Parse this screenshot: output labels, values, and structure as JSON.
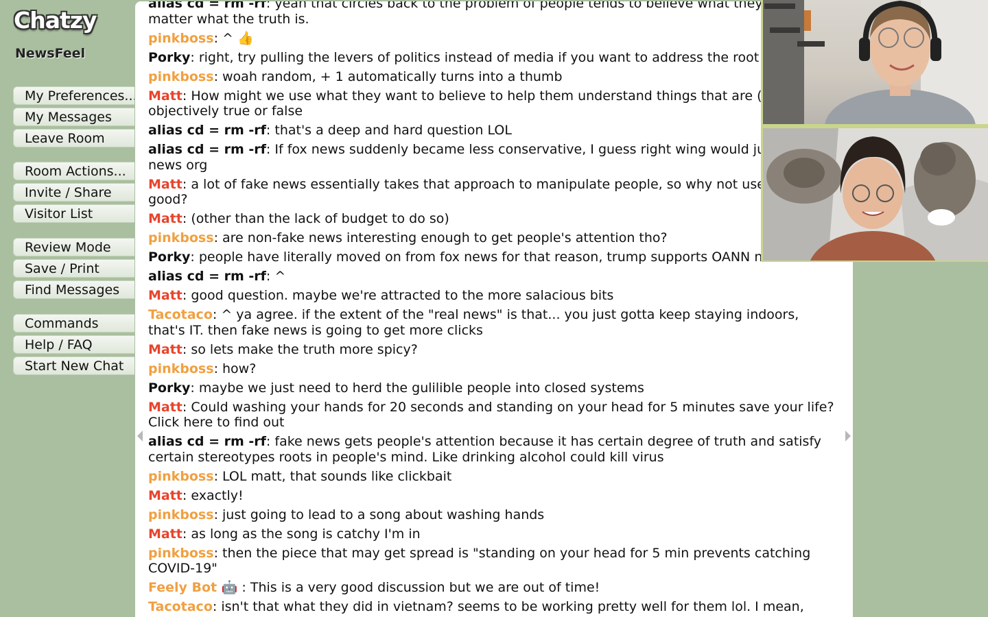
{
  "app": {
    "logo": "Chatzy",
    "room_name": "NewsFeel"
  },
  "menu": {
    "group1": [
      "My Preferences...",
      "My Messages",
      "Leave Room"
    ],
    "group2": [
      "Room Actions...",
      "Invite / Share",
      "Visitor List"
    ],
    "group3": [
      "Review Mode",
      "Save / Print",
      "Find Messages"
    ],
    "group4": [
      "Commands",
      "Help / FAQ",
      "Start New Chat"
    ]
  },
  "colors": {
    "background": "#a9bf9f",
    "matt": "#e8442c",
    "pinkboss": "#f0a040",
    "tacotaco": "#f0a040",
    "feelybot": "#f0a040",
    "default_user": "#111111",
    "video_border": "#c9d58a"
  },
  "messages": [
    {
      "user": "alias cd = rm -rf",
      "sep": ": ",
      "text": "yeah that circles back to the problem of people tends to believe what they wanna matter what the truth is.",
      "color": "default"
    },
    {
      "user": "pinkboss",
      "sep": ": ",
      "text": "^ 👍",
      "color": "orange"
    },
    {
      "user": "Porky",
      "sep": ": ",
      "text": "right, try pulling the levers of politics instead of media if you want to address the root cause",
      "color": "default"
    },
    {
      "user": "pinkboss",
      "sep": ": ",
      "text": "woah random, + 1 automatically turns into a thumb",
      "color": "orange"
    },
    {
      "user": "Matt",
      "sep": ": ",
      "text": "How might we use what they want to believe to help them understand things that are (within r objectively true or false",
      "color": "red"
    },
    {
      "user": "alias cd = rm -rf",
      "sep": ": ",
      "text": "that's a deep and hard question LOL",
      "color": "default"
    },
    {
      "user": "alias cd = rm -rf",
      "sep": ": ",
      "text": "If fox news suddenly became less conservative, I guess right wing would just crea news org",
      "color": "default"
    },
    {
      "user": "Matt",
      "sep": ": ",
      "text": "a lot of fake news essentially takes that approach to manipulate people, so why not use the sar good?",
      "color": "red"
    },
    {
      "user": "Matt",
      "sep": ": ",
      "text": "(other than the lack of budget to do so)",
      "color": "red"
    },
    {
      "user": "pinkboss",
      "sep": ": ",
      "text": "are non-fake news interesting enough to get people's attention tho?",
      "color": "orange"
    },
    {
      "user": "Porky",
      "sep": ": ",
      "text": "people have literally moved on from fox news for that reason, trump supports OANN now",
      "color": "default"
    },
    {
      "user": "alias cd = rm -rf",
      "sep": ": ",
      "text": "^",
      "color": "default"
    },
    {
      "user": "Matt",
      "sep": ": ",
      "text": "good question. maybe we're attracted to the more salacious bits",
      "color": "red"
    },
    {
      "user": "Tacotaco",
      "sep": ": ",
      "text": "^ ya agree. if the extent of the \"real news\" is that... you just gotta keep staying indoors, that's IT. then fake news is going to get more clicks",
      "color": "orange"
    },
    {
      "user": "Matt",
      "sep": ": ",
      "text": "so lets make the truth more spicy?",
      "color": "red"
    },
    {
      "user": "pinkboss",
      "sep": ": ",
      "text": "how?",
      "color": "orange"
    },
    {
      "user": "Porky",
      "sep": ": ",
      "text": "maybe we just need to herd the gulilible people into closed systems",
      "color": "default"
    },
    {
      "user": "Matt",
      "sep": ": ",
      "text": "Could washing your hands for 20 seconds and standing on your head for 5 minutes save your life? Click here to find out",
      "color": "red"
    },
    {
      "user": "alias cd = rm -rf",
      "sep": ": ",
      "text": "fake news gets people's attention because it has certain degree of truth and satisfy certain stereotypes roots in people's mind. Like drinking alcohol could kill virus",
      "color": "default"
    },
    {
      "user": "pinkboss",
      "sep": ": ",
      "text": "LOL matt, that sounds like clickbait",
      "color": "orange"
    },
    {
      "user": "Matt",
      "sep": ": ",
      "text": "exactly!",
      "color": "red"
    },
    {
      "user": "pinkboss",
      "sep": ": ",
      "text": "just going to lead to a song about washing hands",
      "color": "orange"
    },
    {
      "user": "Matt",
      "sep": ": ",
      "text": "as long as the song is catchy I'm in",
      "color": "red"
    },
    {
      "user": "pinkboss",
      "sep": ": ",
      "text": "then the piece that may get spread is \"standing on your head for 5 min prevents catching COVID-19\"",
      "color": "orange"
    },
    {
      "user": "Feely Bot 🤖",
      "sep": " : ",
      "text": "This is a very good discussion but we are out of time!",
      "color": "orange"
    },
    {
      "user": "Tacotaco",
      "sep": ": ",
      "text": "isn't that what they did in vietnam? seems to be working pretty well for them lol. I mean, along w/ a functioning system that takes care of its ppl haha",
      "color": "orange"
    }
  ]
}
